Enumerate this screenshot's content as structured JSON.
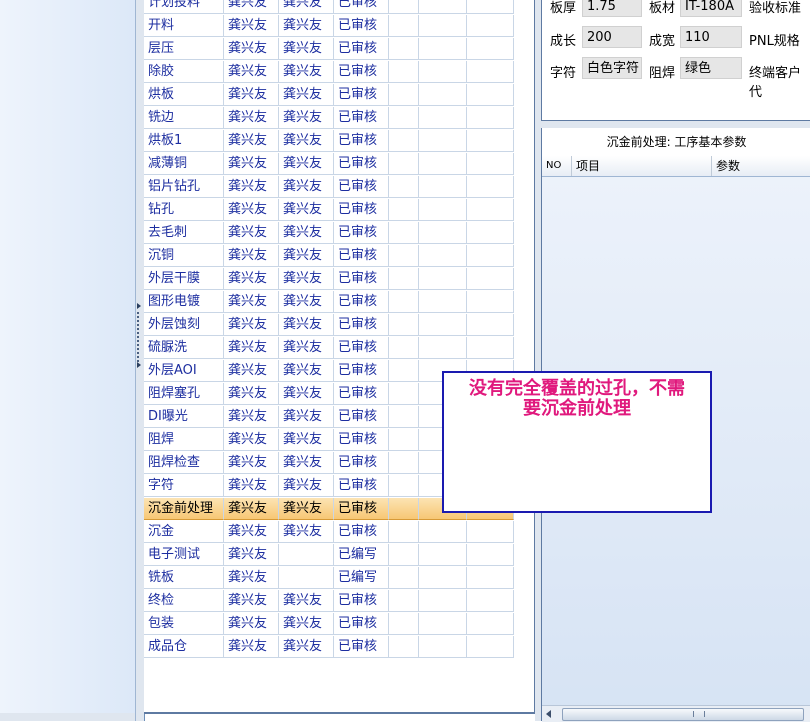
{
  "process_list": {
    "rows": [
      {
        "name": "计划投料",
        "col1": "龚兴友",
        "col2": "龚兴友",
        "status": "已审核"
      },
      {
        "name": "开料",
        "col1": "龚兴友",
        "col2": "龚兴友",
        "status": "已审核"
      },
      {
        "name": "层压",
        "col1": "龚兴友",
        "col2": "龚兴友",
        "status": "已审核"
      },
      {
        "name": "除胶",
        "col1": "龚兴友",
        "col2": "龚兴友",
        "status": "已审核"
      },
      {
        "name": "烘板",
        "col1": "龚兴友",
        "col2": "龚兴友",
        "status": "已审核"
      },
      {
        "name": "铣边",
        "col1": "龚兴友",
        "col2": "龚兴友",
        "status": "已审核"
      },
      {
        "name": "烘板1",
        "col1": "龚兴友",
        "col2": "龚兴友",
        "status": "已审核"
      },
      {
        "name": "减薄铜",
        "col1": "龚兴友",
        "col2": "龚兴友",
        "status": "已审核"
      },
      {
        "name": "铝片钻孔",
        "col1": "龚兴友",
        "col2": "龚兴友",
        "status": "已审核"
      },
      {
        "name": "钻孔",
        "col1": "龚兴友",
        "col2": "龚兴友",
        "status": "已审核"
      },
      {
        "name": "去毛刺",
        "col1": "龚兴友",
        "col2": "龚兴友",
        "status": "已审核"
      },
      {
        "name": "沉铜",
        "col1": "龚兴友",
        "col2": "龚兴友",
        "status": "已审核"
      },
      {
        "name": "外层干膜",
        "col1": "龚兴友",
        "col2": "龚兴友",
        "status": "已审核"
      },
      {
        "name": "图形电镀",
        "col1": "龚兴友",
        "col2": "龚兴友",
        "status": "已审核"
      },
      {
        "name": "外层蚀刻",
        "col1": "龚兴友",
        "col2": "龚兴友",
        "status": "已审核"
      },
      {
        "name": "硫脲洗",
        "col1": "龚兴友",
        "col2": "龚兴友",
        "status": "已审核"
      },
      {
        "name": "外层AOI",
        "col1": "龚兴友",
        "col2": "龚兴友",
        "status": "已审核"
      },
      {
        "name": "阻焊塞孔",
        "col1": "龚兴友",
        "col2": "龚兴友",
        "status": "已审核"
      },
      {
        "name": "DI曝光",
        "col1": "龚兴友",
        "col2": "龚兴友",
        "status": "已审核"
      },
      {
        "name": "阻焊",
        "col1": "龚兴友",
        "col2": "龚兴友",
        "status": "已审核"
      },
      {
        "name": "阻焊检查",
        "col1": "龚兴友",
        "col2": "龚兴友",
        "status": "已审核"
      },
      {
        "name": "字符",
        "col1": "龚兴友",
        "col2": "龚兴友",
        "status": "已审核"
      },
      {
        "name": "沉金前处理",
        "col1": "龚兴友",
        "col2": "龚兴友",
        "status": "已审核"
      },
      {
        "name": "沉金",
        "col1": "龚兴友",
        "col2": "龚兴友",
        "status": "已审核"
      },
      {
        "name": "电子测试",
        "col1": "龚兴友",
        "col2": "",
        "status": "已编写"
      },
      {
        "name": "铣板",
        "col1": "龚兴友",
        "col2": "",
        "status": "已编写"
      },
      {
        "name": "终检",
        "col1": "龚兴友",
        "col2": "龚兴友",
        "status": "已审核"
      },
      {
        "name": "包装",
        "col1": "龚兴友",
        "col2": "龚兴友",
        "status": "已审核"
      },
      {
        "name": "成品仓",
        "col1": "龚兴友",
        "col2": "龚兴友",
        "status": "已审核"
      }
    ]
  },
  "board_info": {
    "thickness_label": "板厚",
    "thickness_value": "1.75",
    "material_label": "板材",
    "material_value": "IT-180A",
    "acceptance_label": "验收标准",
    "length_label": "成长",
    "length_value": "200",
    "width_label": "成宽",
    "width_value": "110",
    "pnl_label": "PNL规格",
    "silkscreen_label": "字符",
    "silkscreen_value": "白色字符",
    "soldermask_label": "阻焊",
    "soldermask_value": "绿色",
    "customer_label": "终端客户代"
  },
  "params_panel": {
    "title": "沉金前处理: 工序基本参数",
    "col_no": "NO",
    "col_item": "项目",
    "col_param": "参数"
  },
  "message": {
    "line1": "没有完全覆盖的过孔，不需",
    "line2": "要沉金前处理"
  },
  "colors": {
    "row_text": "#1d2ea0",
    "selected_row": "#f7c774",
    "message_text": "#e0197d",
    "message_border": "#1a1ab0"
  }
}
